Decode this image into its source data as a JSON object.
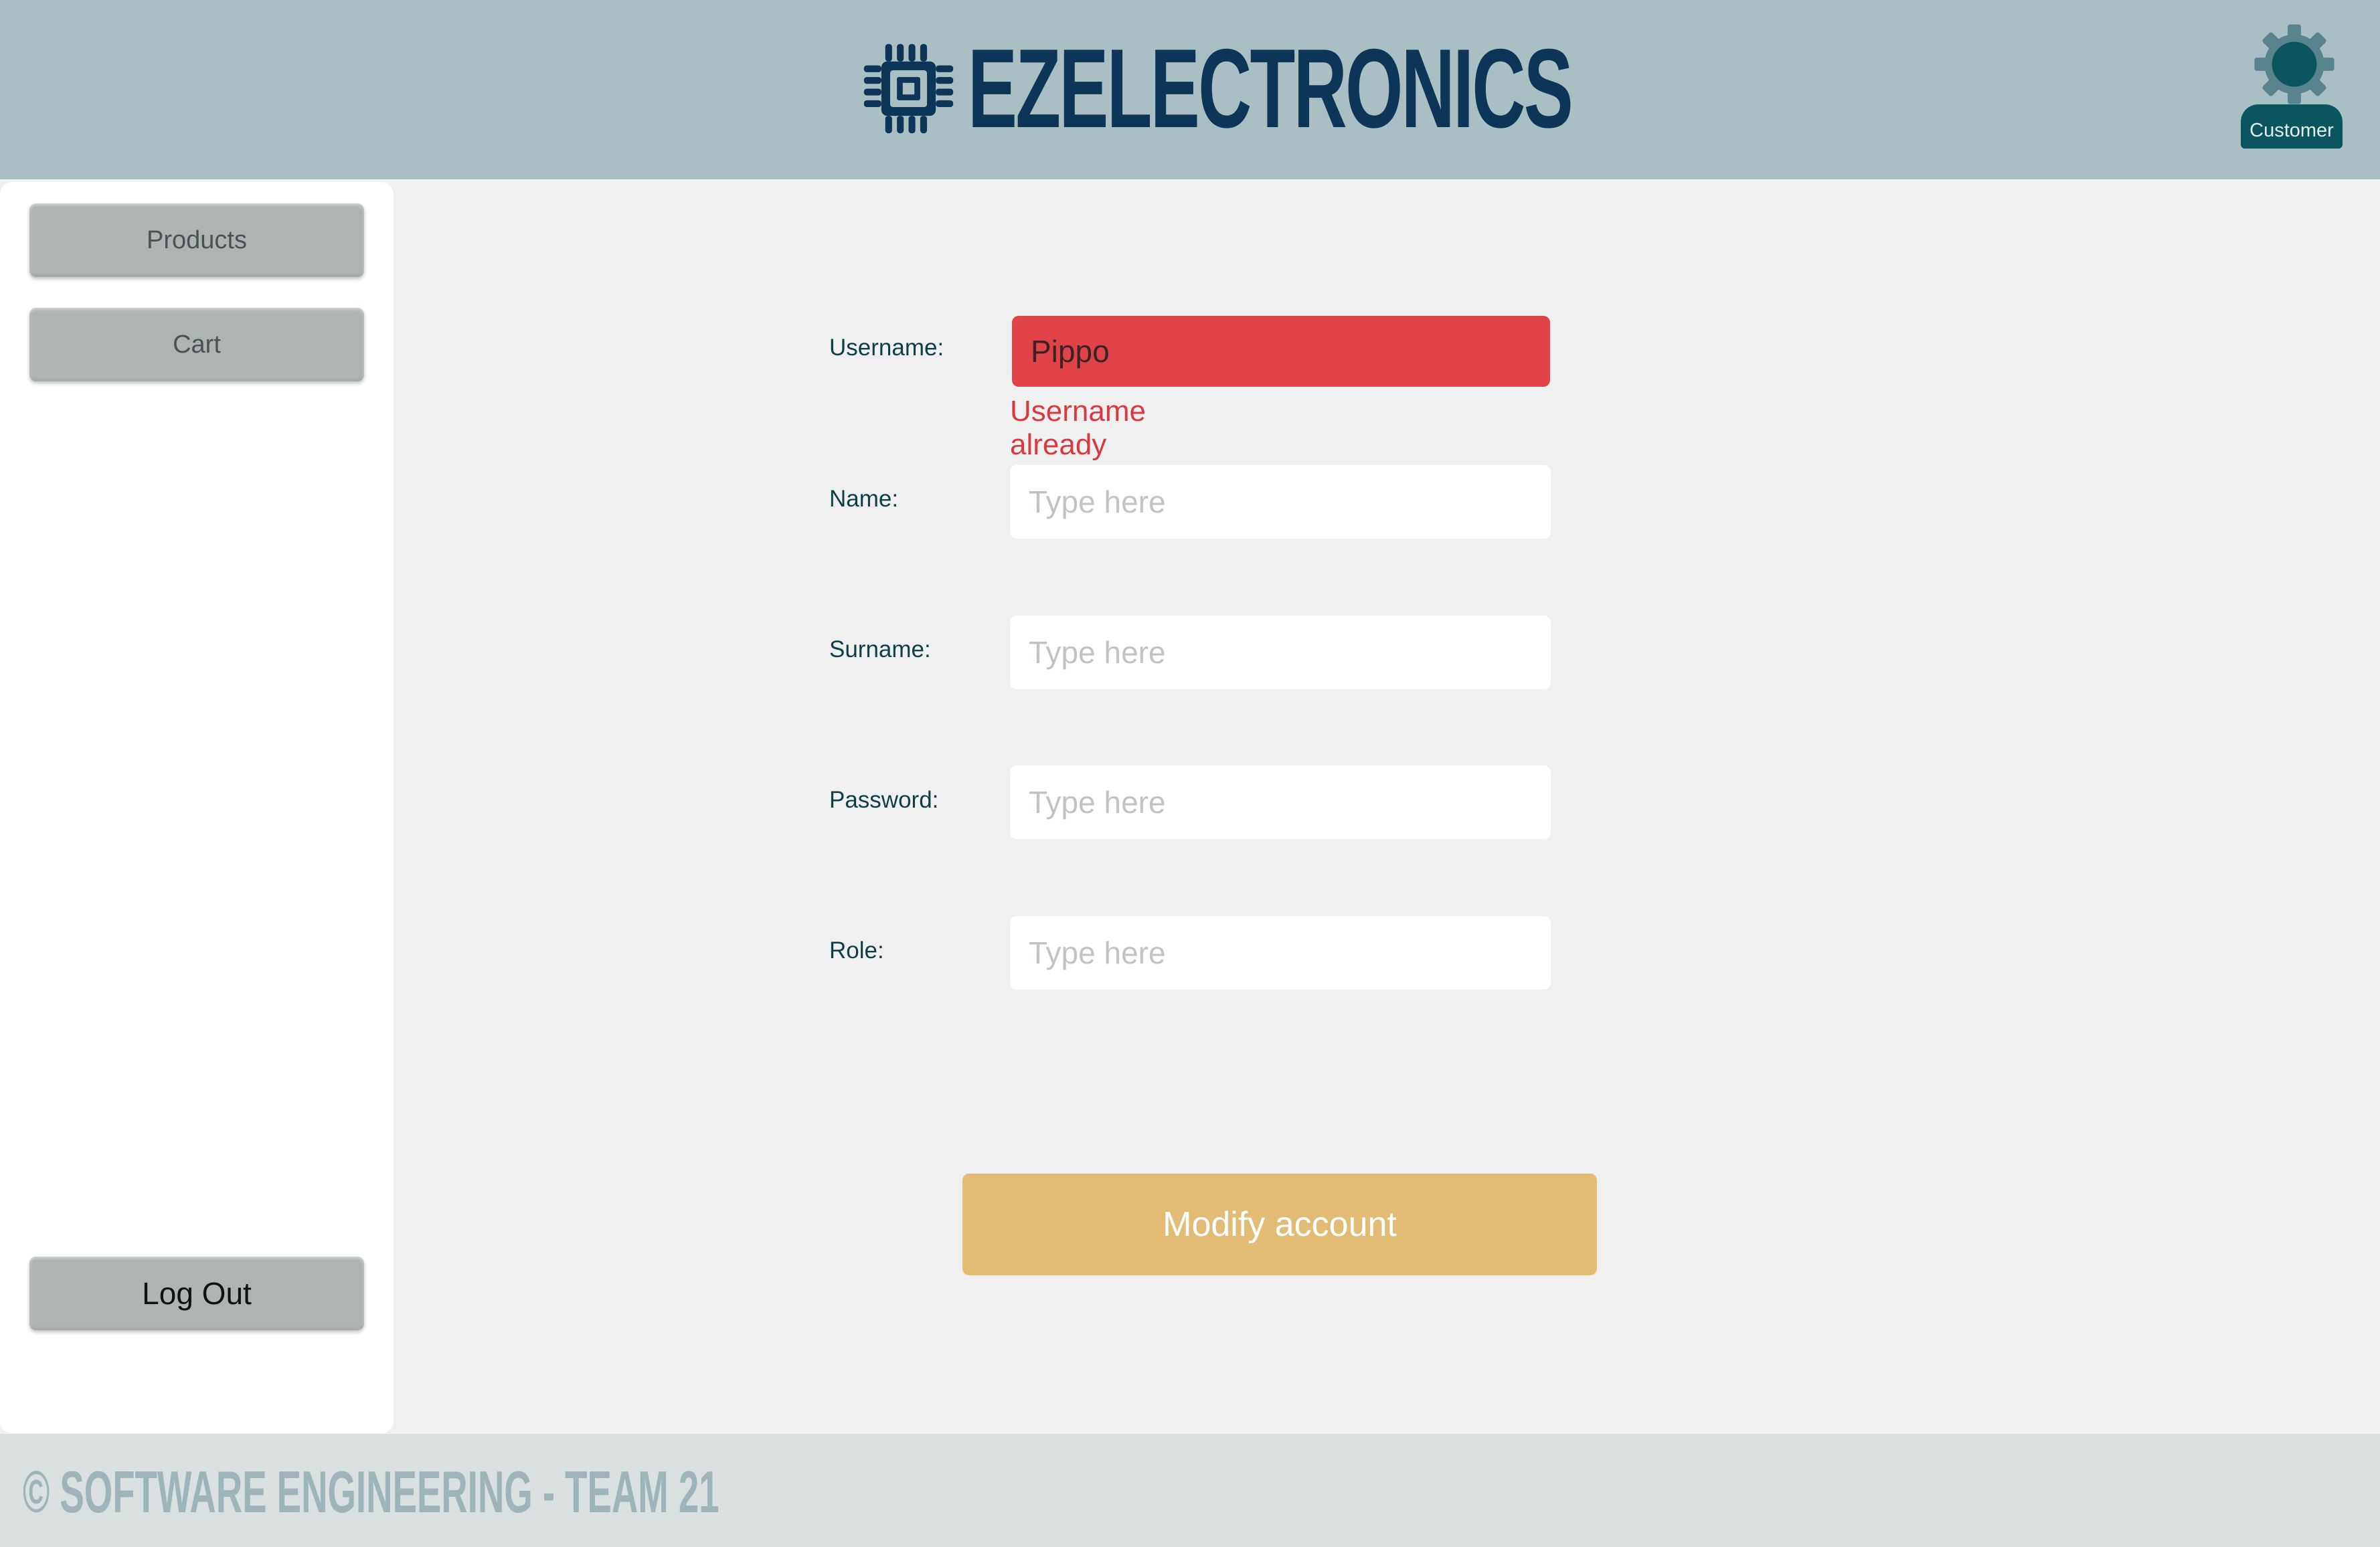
{
  "header": {
    "brand": "EZELECTRONICS",
    "brand_icon": "cpu-chip-icon",
    "user_icon": "gear-icon",
    "user_role": "Customer"
  },
  "sidebar": {
    "items": [
      {
        "label": "Products"
      },
      {
        "label": "Cart"
      }
    ],
    "logout_label": "Log Out"
  },
  "form": {
    "username": {
      "label": "Username:",
      "value": "Pippo",
      "error": "Username already taken"
    },
    "name": {
      "label": "Name:",
      "value": "",
      "placeholder": "Type here"
    },
    "surname": {
      "label": "Surname:",
      "value": "",
      "placeholder": "Type here"
    },
    "password": {
      "label": "Password:",
      "value": "",
      "placeholder": "Type here"
    },
    "role": {
      "label": "Role:",
      "value": "",
      "placeholder": "Type here"
    },
    "submit_label": "Modify account"
  },
  "footer": {
    "text": "© SOFTWARE ENGINEERING - TEAM 21"
  },
  "colors": {
    "header_bg": "#a8bfc3",
    "brand": "#0d3558",
    "error": "#e04347",
    "submit": "#e2bb74",
    "role_badge": "#0a5560"
  }
}
